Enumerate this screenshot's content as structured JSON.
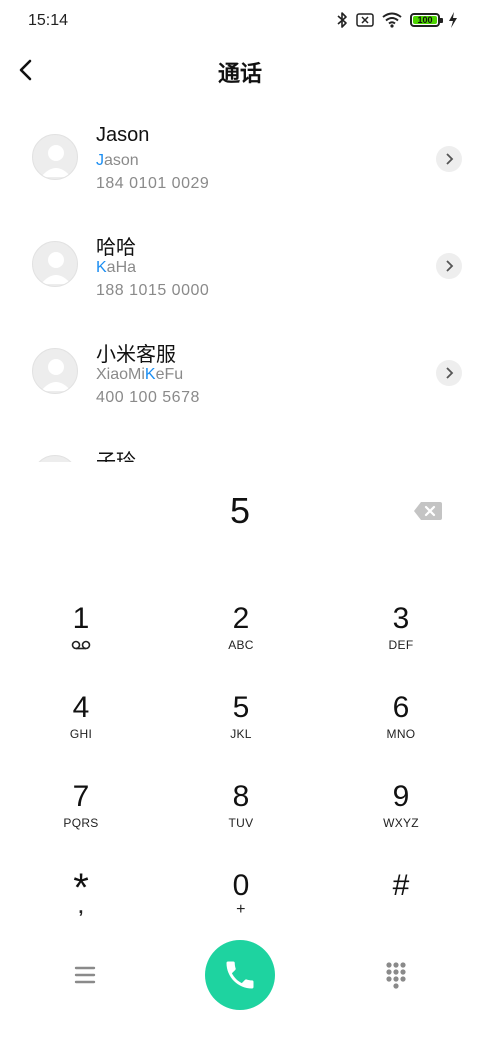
{
  "status_bar": {
    "time": "15:14",
    "battery": "100"
  },
  "header": {
    "title": "通话"
  },
  "contacts": [
    {
      "name": "Jason",
      "pinyin_match": "J",
      "pinyin_rest": "ason",
      "pinyin_pre": "",
      "number": "184 0101 0029"
    },
    {
      "name": "哈哈",
      "pinyin_pre": "",
      "pinyin_match": "K",
      "pinyin_rest": "aHa",
      "number": "188 1015 0000"
    },
    {
      "name": "小米客服",
      "pinyin_pre": "XiaoMi",
      "pinyin_match": "K",
      "pinyin_rest": "eFu",
      "number": "400 100 5678"
    },
    {
      "name": "子玲",
      "pinyin_pre": "",
      "pinyin_match": "",
      "pinyin_rest": "",
      "number": ""
    }
  ],
  "dial": {
    "typed": "5"
  },
  "keys": [
    {
      "digit": "1",
      "letters": ""
    },
    {
      "digit": "2",
      "letters": "ABC"
    },
    {
      "digit": "3",
      "letters": "DEF"
    },
    {
      "digit": "4",
      "letters": "GHI"
    },
    {
      "digit": "5",
      "letters": "JKL"
    },
    {
      "digit": "6",
      "letters": "MNO"
    },
    {
      "digit": "7",
      "letters": "PQRS"
    },
    {
      "digit": "8",
      "letters": "TUV"
    },
    {
      "digit": "9",
      "letters": "WXYZ"
    },
    {
      "digit": "*",
      "letters": ","
    },
    {
      "digit": "0",
      "letters": "+"
    },
    {
      "digit": "#",
      "letters": ""
    }
  ],
  "colors": {
    "accent": "#1ed3a0",
    "highlight": "#1b8ef2",
    "battery": "#4cd400"
  },
  "icons": [
    "bluetooth-icon",
    "sim-off-icon",
    "wifi-icon",
    "battery-icon",
    "charging-icon",
    "back-icon",
    "chevron-right-icon",
    "backspace-icon",
    "voicemail-icon",
    "menu-icon",
    "phone-icon",
    "dialpad-icon"
  ]
}
